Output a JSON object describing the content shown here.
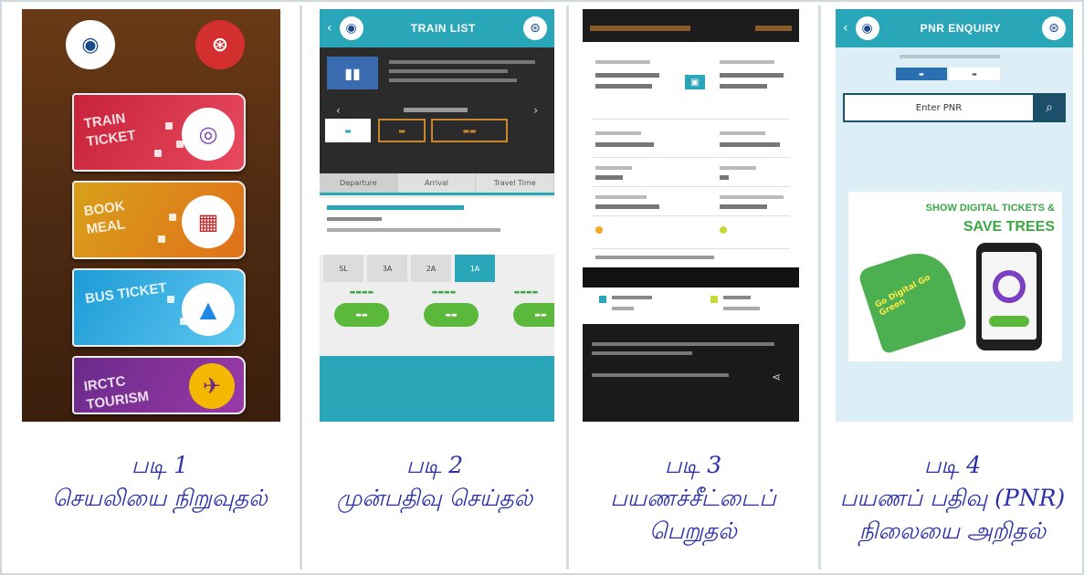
{
  "captions": [
    {
      "line1": "படி 1",
      "line2": "செயலியை நிறுவுதல்",
      "line3": ""
    },
    {
      "line1": "படி 2",
      "line2": "முன்பதிவு செய்தல்",
      "line3": ""
    },
    {
      "line1": "படி 3",
      "line2": "பயணச்சீட்டைப்",
      "line3": "பெறுதல்"
    },
    {
      "line1": "படி 4",
      "line2": "பயணப் பதிவு (PNR)",
      "line3": "நிலையை அறிதல்"
    }
  ],
  "panel1": {
    "menu": [
      {
        "label": "Train Ticket",
        "color": "#c7223a",
        "icon": "rail-logo-icon"
      },
      {
        "label": "Book Meal",
        "color": "#e08a16",
        "icon": "food-icon"
      },
      {
        "label": "Bus Ticket",
        "color": "#1e9bd7",
        "icon": "bus-icon"
      },
      {
        "label": "IRCTC Tourism",
        "color": "#6a2a8a",
        "icon": "tourism-icon"
      }
    ]
  },
  "panel2": {
    "appbar_title": "TRAIN LIST",
    "tabs": [
      "Departure",
      "Arrival",
      "Travel Time"
    ],
    "classes": [
      "SL",
      "3A",
      "2A",
      "1A"
    ]
  },
  "panel4": {
    "appbar_title": "PNR ENQUIRY",
    "pnr_placeholder": "Enter PNR",
    "banner_line1": "SHOW DIGITAL TICKETS &",
    "banner_line2": "SAVE TREES",
    "thumb_text": "Go Digital Go Green"
  },
  "colors": {
    "caption": "#2b2fa8",
    "app_teal": "#2aa6b9",
    "book_green": "#5cb83a"
  }
}
